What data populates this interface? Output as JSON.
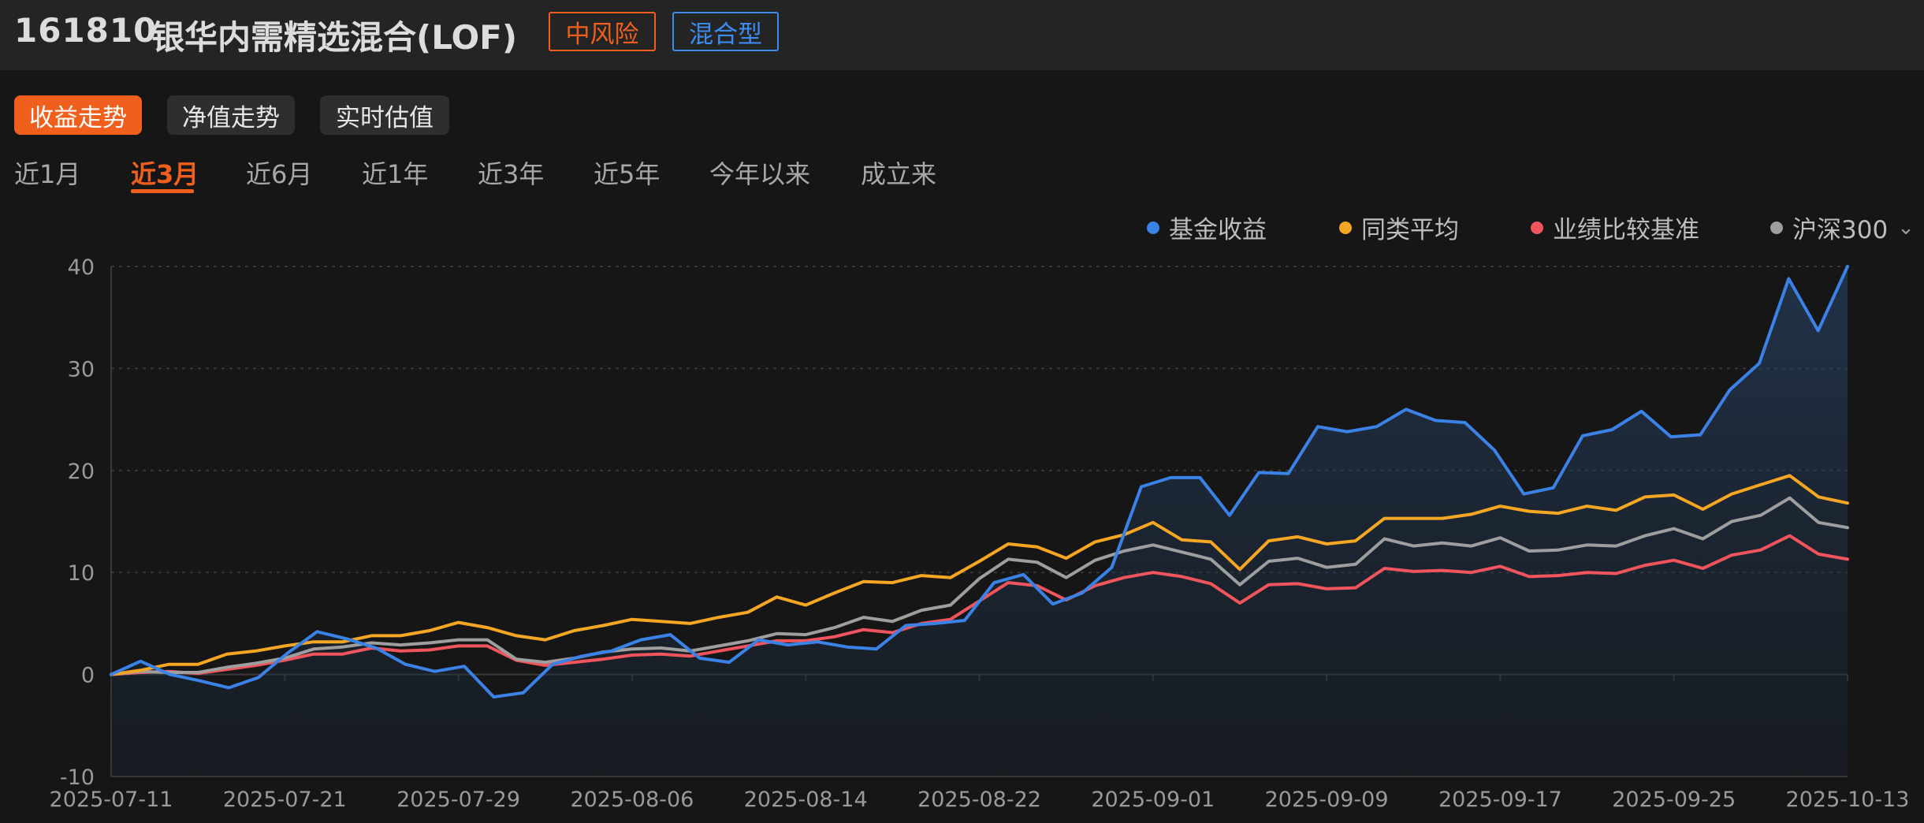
{
  "header": {
    "code": "161810",
    "name": "银华内需精选混合(LOF)",
    "risk_tag": "中风险",
    "type_tag": "混合型"
  },
  "view_tabs": [
    {
      "label": "收益走势",
      "active": true
    },
    {
      "label": "净值走势",
      "active": false
    },
    {
      "label": "实时估值",
      "active": false
    }
  ],
  "range_tabs": [
    {
      "label": "近1月",
      "active": false
    },
    {
      "label": "近3月",
      "active": true
    },
    {
      "label": "近6月",
      "active": false
    },
    {
      "label": "近1年",
      "active": false
    },
    {
      "label": "近3年",
      "active": false
    },
    {
      "label": "近5年",
      "active": false
    },
    {
      "label": "今年以来",
      "active": false
    },
    {
      "label": "成立来",
      "active": false
    }
  ],
  "legend": [
    {
      "label": "基金收益",
      "color": "#3b82e6"
    },
    {
      "label": "同类平均",
      "color": "#f5a623"
    },
    {
      "label": "业绩比较基准",
      "color": "#f0545c"
    },
    {
      "label": "沪深300",
      "color": "#9e9e9e",
      "dropdown": "chevron-down-icon"
    }
  ],
  "chart_data": {
    "type": "line",
    "ylim": [
      -10,
      40
    ],
    "yticks": [
      "40",
      "30",
      "20",
      "10",
      "0",
      "-10"
    ],
    "xticks": [
      "2025-07-11",
      "2025-07-21",
      "2025-07-29",
      "2025-08-06",
      "2025-08-14",
      "2025-08-22",
      "2025-09-01",
      "2025-09-09",
      "2025-09-17",
      "2025-09-25",
      "2025-10-13"
    ],
    "grid": "horizontal-dashed",
    "legend_position": "top-right",
    "series": [
      {
        "name": "基金收益",
        "color": "#3b82e6",
        "filled": true,
        "values": [
          0,
          1.3,
          0,
          -0.6,
          -1.3,
          -0.3,
          2.1,
          4.2,
          3.5,
          2.6,
          1.0,
          0.3,
          0.8,
          -2.2,
          -1.8,
          1.0,
          1.8,
          2.3,
          3.4,
          3.9,
          1.6,
          1.2,
          3.4,
          2.9,
          3.2,
          2.7,
          2.5,
          4.8,
          5.0,
          5.3,
          9.0,
          9.8,
          6.9,
          8.0,
          10.5,
          18.4,
          19.3,
          19.3,
          15.6,
          19.8,
          19.7,
          24.3,
          23.8,
          24.3,
          26.0,
          24.9,
          24.7,
          22.0,
          17.7,
          18.3,
          23.4,
          24.0,
          25.8,
          23.3,
          23.5,
          27.9,
          30.5,
          38.8,
          33.7,
          40.0
        ]
      },
      {
        "name": "同类平均",
        "color": "#f5a623",
        "filled": false,
        "values": [
          0,
          0.4,
          1.0,
          1.0,
          2.0,
          2.3,
          2.8,
          3.2,
          3.2,
          3.8,
          3.8,
          4.3,
          5.1,
          4.6,
          3.8,
          3.4,
          4.3,
          4.8,
          5.4,
          5.2,
          5.0,
          5.6,
          6.1,
          7.6,
          6.8,
          8.0,
          9.1,
          9.0,
          9.7,
          9.5,
          11.1,
          12.8,
          12.5,
          11.4,
          13.0,
          13.7,
          14.9,
          13.2,
          13.0,
          10.3,
          13.1,
          13.5,
          12.8,
          13.1,
          15.3,
          15.3,
          15.3,
          15.7,
          16.5,
          16.0,
          15.8,
          16.5,
          16.1,
          17.4,
          17.6,
          16.2,
          17.7,
          18.6,
          19.5,
          17.4,
          16.8
        ]
      },
      {
        "name": "业绩比较基准",
        "color": "#f0545c",
        "filled": false,
        "values": [
          0,
          0.2,
          0.3,
          0.1,
          0.5,
          0.9,
          1.4,
          2.0,
          2.0,
          2.6,
          2.3,
          2.4,
          2.8,
          2.8,
          1.4,
          0.9,
          1.2,
          1.5,
          1.9,
          2.0,
          1.8,
          2.3,
          2.8,
          3.3,
          3.3,
          3.7,
          4.4,
          4.1,
          5.0,
          5.4,
          7.2,
          9.0,
          8.7,
          7.3,
          8.7,
          9.5,
          10.0,
          9.6,
          8.9,
          7.0,
          8.8,
          8.9,
          8.4,
          8.5,
          10.4,
          10.1,
          10.2,
          10.0,
          10.6,
          9.6,
          9.7,
          10.0,
          9.9,
          10.7,
          11.2,
          10.4,
          11.7,
          12.2,
          13.6,
          11.8,
          11.3
        ]
      },
      {
        "name": "沪深300",
        "color": "#9e9e9e",
        "filled": false,
        "values": [
          0,
          0.3,
          0.2,
          0.2,
          0.7,
          1.1,
          1.6,
          2.5,
          2.7,
          3.1,
          2.9,
          3.1,
          3.4,
          3.4,
          1.5,
          1.2,
          1.6,
          2.2,
          2.5,
          2.6,
          2.3,
          2.8,
          3.3,
          4.0,
          3.9,
          4.6,
          5.6,
          5.2,
          6.3,
          6.8,
          9.4,
          11.3,
          11.0,
          9.5,
          11.2,
          12.1,
          12.7,
          12.0,
          11.3,
          8.8,
          11.1,
          11.4,
          10.5,
          10.8,
          13.3,
          12.6,
          12.9,
          12.6,
          13.4,
          12.1,
          12.2,
          12.7,
          12.6,
          13.6,
          14.3,
          13.3,
          15.0,
          15.6,
          17.3,
          14.9,
          14.4
        ]
      }
    ]
  }
}
